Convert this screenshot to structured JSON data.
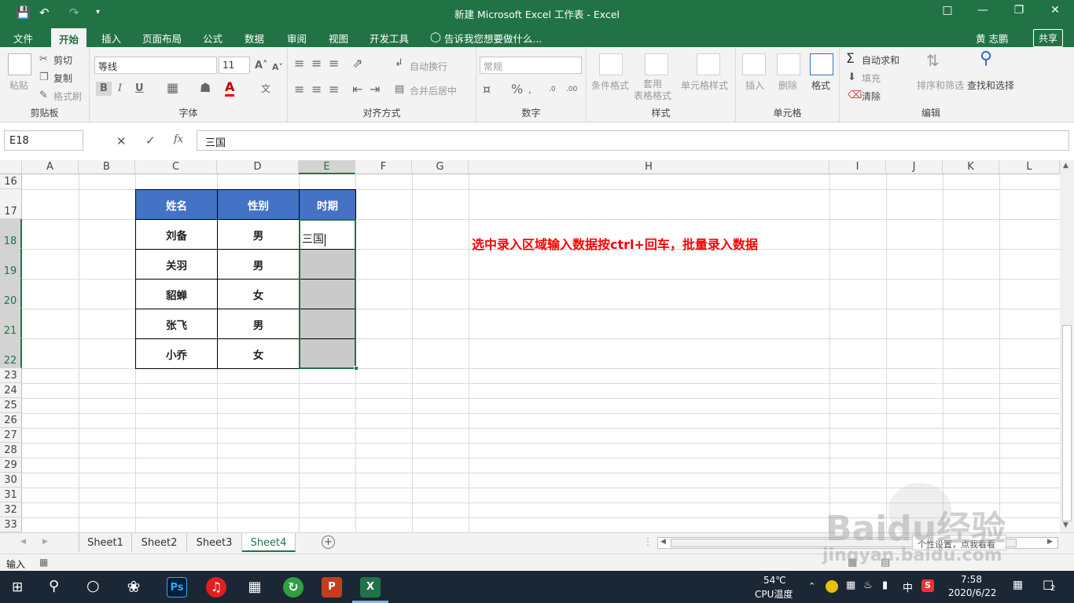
{
  "window": {
    "title": "新建 Microsoft Excel 工作表 - Excel",
    "user": "黄 志鹏",
    "share": "共享"
  },
  "tabs": [
    "文件",
    "开始",
    "插入",
    "页面布局",
    "公式",
    "数据",
    "审阅",
    "视图",
    "开发工具"
  ],
  "tell_me": "告诉我您想要做什么...",
  "ribbon": {
    "clipboard": {
      "label": "剪贴板",
      "paste": "粘贴",
      "cut": "剪切",
      "copy": "复制",
      "format_painter": "格式刷"
    },
    "font": {
      "label": "字体",
      "name": "等线",
      "size": "11",
      "bold": "B",
      "italic": "I",
      "underline": "U"
    },
    "alignment": {
      "label": "对齐方式",
      "wrap": "自动换行",
      "merge": "合并后居中"
    },
    "number": {
      "label": "数字",
      "format": "常规"
    },
    "styles": {
      "label": "样式",
      "conditional": "条件格式",
      "table": "套用\n表格格式",
      "cell_styles": "单元格样式"
    },
    "cells": {
      "label": "单元格",
      "insert": "插入",
      "delete": "删除",
      "format": "格式"
    },
    "editing": {
      "label": "编辑",
      "autosum": "自动求和",
      "fill": "填充",
      "clear": "清除",
      "sort": "排序和筛选",
      "find": "查找和选择"
    }
  },
  "formula_bar": {
    "name_box": "E18",
    "content": "三国",
    "fx": "fx"
  },
  "columns": [
    "A",
    "B",
    "C",
    "D",
    "E",
    "F",
    "G",
    "H",
    "I",
    "J",
    "K",
    "L"
  ],
  "rows": [
    "16",
    "17",
    "18",
    "19",
    "20",
    "21",
    "22",
    "23",
    "24",
    "25",
    "26",
    "27",
    "28",
    "29",
    "30",
    "31",
    "32",
    "33"
  ],
  "table": {
    "headers": [
      "姓名",
      "性别",
      "时期"
    ],
    "rows": [
      [
        "刘备",
        "男",
        "三国"
      ],
      [
        "关羽",
        "男",
        ""
      ],
      [
        "貂蝉",
        "女",
        ""
      ],
      [
        "张飞",
        "男",
        ""
      ],
      [
        "小乔",
        "女",
        ""
      ]
    ]
  },
  "note": "选中录入区域输入数据按ctrl+回车，批量录入数据",
  "sheets": [
    "Sheet1",
    "Sheet2",
    "Sheet3",
    "Sheet4"
  ],
  "active_sheet": "Sheet4",
  "status": {
    "mode": "输入"
  },
  "hint_overlay": "个性设置，点我看看",
  "watermark": "Baidu经验",
  "watermark_url": "jingyan.baidu.com",
  "taskbar": {
    "temp": "54℃",
    "temp_label": "CPU温度",
    "ime": "中",
    "time": "7:58",
    "date": "2020/6/22",
    "notifications": "2"
  }
}
